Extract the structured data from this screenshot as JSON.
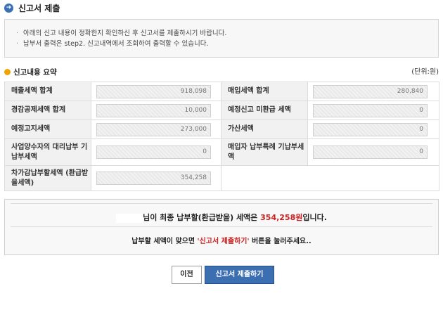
{
  "header": {
    "title": "신고서 제출"
  },
  "notice": {
    "lines": [
      "아래의 신고 내용이 정확한지 확인하신 후 신고서를 제출하시기 바랍니다.",
      "납부서 출력은 step2. 신고내역에서 조회하여 출력할 수 있습니다."
    ]
  },
  "summary": {
    "title": "신고내용 요약",
    "unit": "(단위:원)",
    "rows": [
      {
        "label_left": "매출세액 합계",
        "value_left": "918,098",
        "label_right": "매입세액 합계",
        "value_right": "280,840"
      },
      {
        "label_left": "경감공제세액 합계",
        "value_left": "10,000",
        "label_right": "예정신고 미환급 세액",
        "value_right": "0"
      },
      {
        "label_left": "예정고지세액",
        "value_left": "273,000",
        "label_right": "가산세액",
        "value_right": "0"
      },
      {
        "label_left": "사업양수자의 대리납부 기납부세액",
        "value_left": "0",
        "label_right": "매입자 납부특례 기납부세액",
        "value_right": "0"
      },
      {
        "label_left": "차가감납부할세액 (환급받을세액)",
        "value_left": "354,258"
      }
    ]
  },
  "result": {
    "line1_prefix": "님이 최종 납부할(환급받을) 세액은 ",
    "amount": "354,258원",
    "line1_suffix": "입니다.",
    "line2_prefix": "납부할 세액이 맞으면 ",
    "line2_quote": "'신고서 제출하기'",
    "line2_suffix": " 버튼을 눌러주세요.."
  },
  "buttons": {
    "prev": "이전",
    "submit": "신고서 제출하기"
  },
  "colors": {
    "accent_blue": "#3c6fb2",
    "highlight_red": "#cc1f1f",
    "section_orange": "#f0a400"
  }
}
